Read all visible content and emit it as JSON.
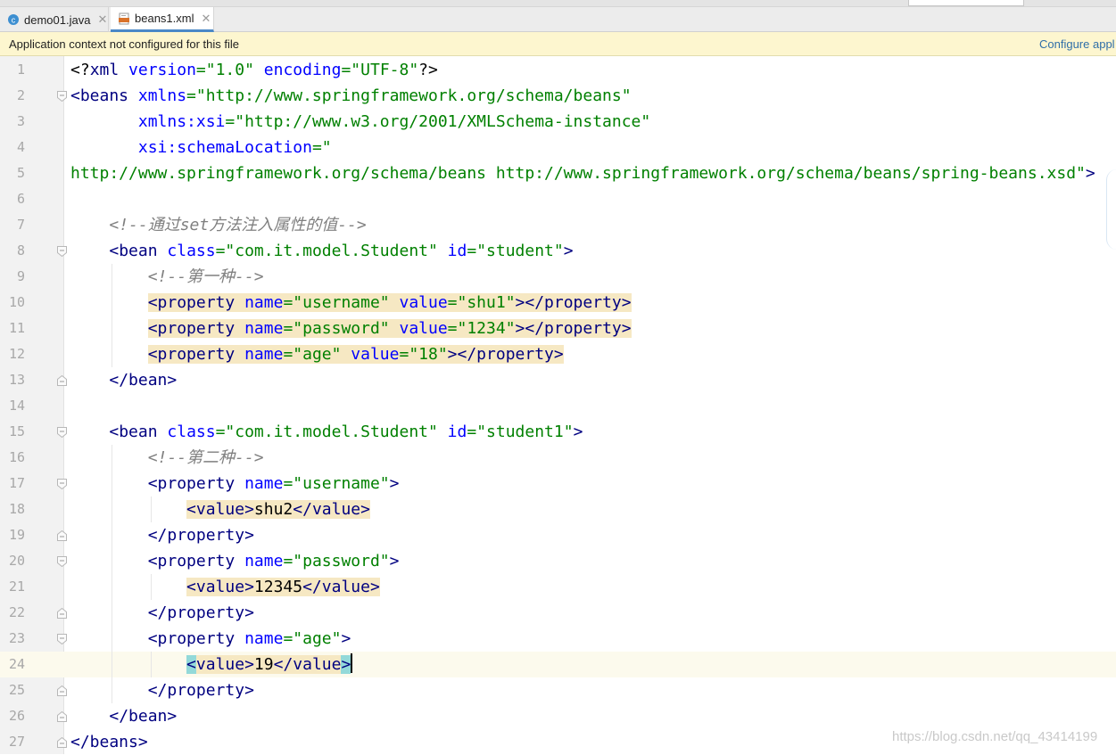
{
  "tabs": [
    {
      "label": "demo01.java",
      "icon": "java-class-icon",
      "active": false
    },
    {
      "label": "beans1.xml",
      "icon": "xml-file-icon",
      "active": true
    }
  ],
  "banner": {
    "message": "Application context not configured for this file",
    "action": "Configure appl"
  },
  "editor": {
    "current_line": 24,
    "lines": [
      {
        "n": "1",
        "parts": [
          {
            "c": "pi",
            "t": "<?"
          },
          {
            "c": "tg",
            "t": "xml "
          },
          {
            "c": "at",
            "t": "version"
          },
          {
            "c": "av",
            "t": "=\"1.0\" "
          },
          {
            "c": "at",
            "t": "encoding"
          },
          {
            "c": "av",
            "t": "=\"UTF-8\""
          },
          {
            "c": "pi",
            "t": "?>"
          }
        ]
      },
      {
        "n": "2",
        "parts": [
          {
            "c": "tg",
            "t": "<beans "
          },
          {
            "c": "at",
            "t": "xmlns"
          },
          {
            "c": "av",
            "t": "=\"http://www.springframework.org/schema/beans\""
          }
        ]
      },
      {
        "n": "3",
        "parts": [
          {
            "c": "ind",
            "t": "       "
          },
          {
            "c": "at",
            "t": "xmlns:xsi"
          },
          {
            "c": "av",
            "t": "=\"http://www.w3.org/2001/XMLSchema-instance\""
          }
        ]
      },
      {
        "n": "4",
        "parts": [
          {
            "c": "ind",
            "t": "       "
          },
          {
            "c": "at",
            "t": "xsi:schemaLocation"
          },
          {
            "c": "av",
            "t": "=\""
          }
        ]
      },
      {
        "n": "5",
        "parts": [
          {
            "c": "av",
            "t": "http://www.springframework.org/schema/beans http://www.springframework.org/schema/beans/spring-beans.xsd\""
          },
          {
            "c": "tg",
            "t": ">"
          }
        ]
      },
      {
        "n": "6",
        "parts": []
      },
      {
        "n": "7",
        "parts": [
          {
            "c": "ind",
            "t": "    "
          },
          {
            "c": "cm",
            "t": "<!--通过set方法注入属性的值-->"
          }
        ]
      },
      {
        "n": "8",
        "parts": [
          {
            "c": "ind",
            "t": "    "
          },
          {
            "c": "tg",
            "t": "<bean "
          },
          {
            "c": "at",
            "t": "class"
          },
          {
            "c": "av",
            "t": "=\"com.it.model.Student\" "
          },
          {
            "c": "at",
            "t": "id"
          },
          {
            "c": "av",
            "t": "=\"student\""
          },
          {
            "c": "tg",
            "t": ">"
          }
        ]
      },
      {
        "n": "9",
        "parts": [
          {
            "c": "ind",
            "t": "        "
          },
          {
            "c": "cm",
            "t": "<!--第一种-->"
          }
        ]
      },
      {
        "n": "10",
        "parts": [
          {
            "c": "ind",
            "t": "        "
          },
          {
            "c": "tg hl",
            "t": "<property "
          },
          {
            "c": "at hl",
            "t": "name"
          },
          {
            "c": "av hl",
            "t": "=\"username\" "
          },
          {
            "c": "at hl",
            "t": "value"
          },
          {
            "c": "av hl",
            "t": "=\"shu1\""
          },
          {
            "c": "tg hl",
            "t": "></property>"
          }
        ]
      },
      {
        "n": "11",
        "parts": [
          {
            "c": "ind",
            "t": "        "
          },
          {
            "c": "tg hl",
            "t": "<property "
          },
          {
            "c": "at hl",
            "t": "name"
          },
          {
            "c": "av hl",
            "t": "=\"password\" "
          },
          {
            "c": "at hl",
            "t": "value"
          },
          {
            "c": "av hl",
            "t": "=\"1234\""
          },
          {
            "c": "tg hl",
            "t": "></property>"
          }
        ]
      },
      {
        "n": "12",
        "parts": [
          {
            "c": "ind",
            "t": "        "
          },
          {
            "c": "tg hl",
            "t": "<property "
          },
          {
            "c": "at hl",
            "t": "name"
          },
          {
            "c": "av hl",
            "t": "=\"age\" "
          },
          {
            "c": "at hl",
            "t": "value"
          },
          {
            "c": "av hl",
            "t": "=\"18\""
          },
          {
            "c": "tg hl",
            "t": "></property>"
          }
        ]
      },
      {
        "n": "13",
        "parts": [
          {
            "c": "ind",
            "t": "    "
          },
          {
            "c": "tg",
            "t": "</bean>"
          }
        ]
      },
      {
        "n": "14",
        "parts": []
      },
      {
        "n": "15",
        "parts": [
          {
            "c": "ind",
            "t": "    "
          },
          {
            "c": "tg",
            "t": "<bean "
          },
          {
            "c": "at",
            "t": "class"
          },
          {
            "c": "av",
            "t": "=\"com.it.model.Student\" "
          },
          {
            "c": "at",
            "t": "id"
          },
          {
            "c": "av",
            "t": "=\"student1\""
          },
          {
            "c": "tg",
            "t": ">"
          }
        ]
      },
      {
        "n": "16",
        "parts": [
          {
            "c": "ind",
            "t": "        "
          },
          {
            "c": "cm",
            "t": "<!--第二种-->"
          }
        ]
      },
      {
        "n": "17",
        "parts": [
          {
            "c": "ind",
            "t": "        "
          },
          {
            "c": "tg",
            "t": "<property "
          },
          {
            "c": "at",
            "t": "name"
          },
          {
            "c": "av",
            "t": "=\"username\""
          },
          {
            "c": "tg",
            "t": ">"
          }
        ]
      },
      {
        "n": "18",
        "parts": [
          {
            "c": "ind",
            "t": "            "
          },
          {
            "c": "tg hl",
            "t": "<value>"
          },
          {
            "c": "ind hl",
            "t": "shu2"
          },
          {
            "c": "tg hl",
            "t": "</value>"
          }
        ]
      },
      {
        "n": "19",
        "parts": [
          {
            "c": "ind",
            "t": "        "
          },
          {
            "c": "tg",
            "t": "</property>"
          }
        ]
      },
      {
        "n": "20",
        "parts": [
          {
            "c": "ind",
            "t": "        "
          },
          {
            "c": "tg",
            "t": "<property "
          },
          {
            "c": "at",
            "t": "name"
          },
          {
            "c": "av",
            "t": "=\"password\""
          },
          {
            "c": "tg",
            "t": ">"
          }
        ]
      },
      {
        "n": "21",
        "parts": [
          {
            "c": "ind",
            "t": "            "
          },
          {
            "c": "tg hl",
            "t": "<value>"
          },
          {
            "c": "ind hl",
            "t": "12345"
          },
          {
            "c": "tg hl",
            "t": "</value>"
          }
        ]
      },
      {
        "n": "22",
        "parts": [
          {
            "c": "ind",
            "t": "        "
          },
          {
            "c": "tg",
            "t": "</property>"
          }
        ]
      },
      {
        "n": "23",
        "parts": [
          {
            "c": "ind",
            "t": "        "
          },
          {
            "c": "tg",
            "t": "<property "
          },
          {
            "c": "at",
            "t": "name"
          },
          {
            "c": "av",
            "t": "=\"age\""
          },
          {
            "c": "tg",
            "t": ">"
          }
        ]
      },
      {
        "n": "24",
        "parts": [
          {
            "c": "ind",
            "t": "            "
          },
          {
            "c": "tg mt",
            "t": "<"
          },
          {
            "c": "tg hl",
            "t": "value>"
          },
          {
            "c": "ind hl",
            "t": "19"
          },
          {
            "c": "tg hl",
            "t": "</value"
          },
          {
            "c": "tg mt",
            "t": ">"
          }
        ]
      },
      {
        "n": "25",
        "parts": [
          {
            "c": "ind",
            "t": "        "
          },
          {
            "c": "tg",
            "t": "</property>"
          }
        ]
      },
      {
        "n": "26",
        "parts": [
          {
            "c": "ind",
            "t": "    "
          },
          {
            "c": "tg",
            "t": "</bean>"
          }
        ]
      },
      {
        "n": "27",
        "parts": [
          {
            "c": "tg",
            "t": "</beans>"
          }
        ]
      }
    ],
    "fold_open_lines": [
      2,
      8,
      15,
      17,
      20,
      23
    ],
    "fold_close_lines": [
      13,
      19,
      22,
      25,
      26,
      27
    ]
  },
  "watermark": "https://blog.csdn.net/qq_43414199",
  "colors": {
    "tag": "#000080",
    "attribute": "#0000ff",
    "value": "#008000",
    "comment": "#808080",
    "highlight": "#f6e8c3",
    "match": "#93d9d9",
    "caret_line": "#fcfaed"
  }
}
